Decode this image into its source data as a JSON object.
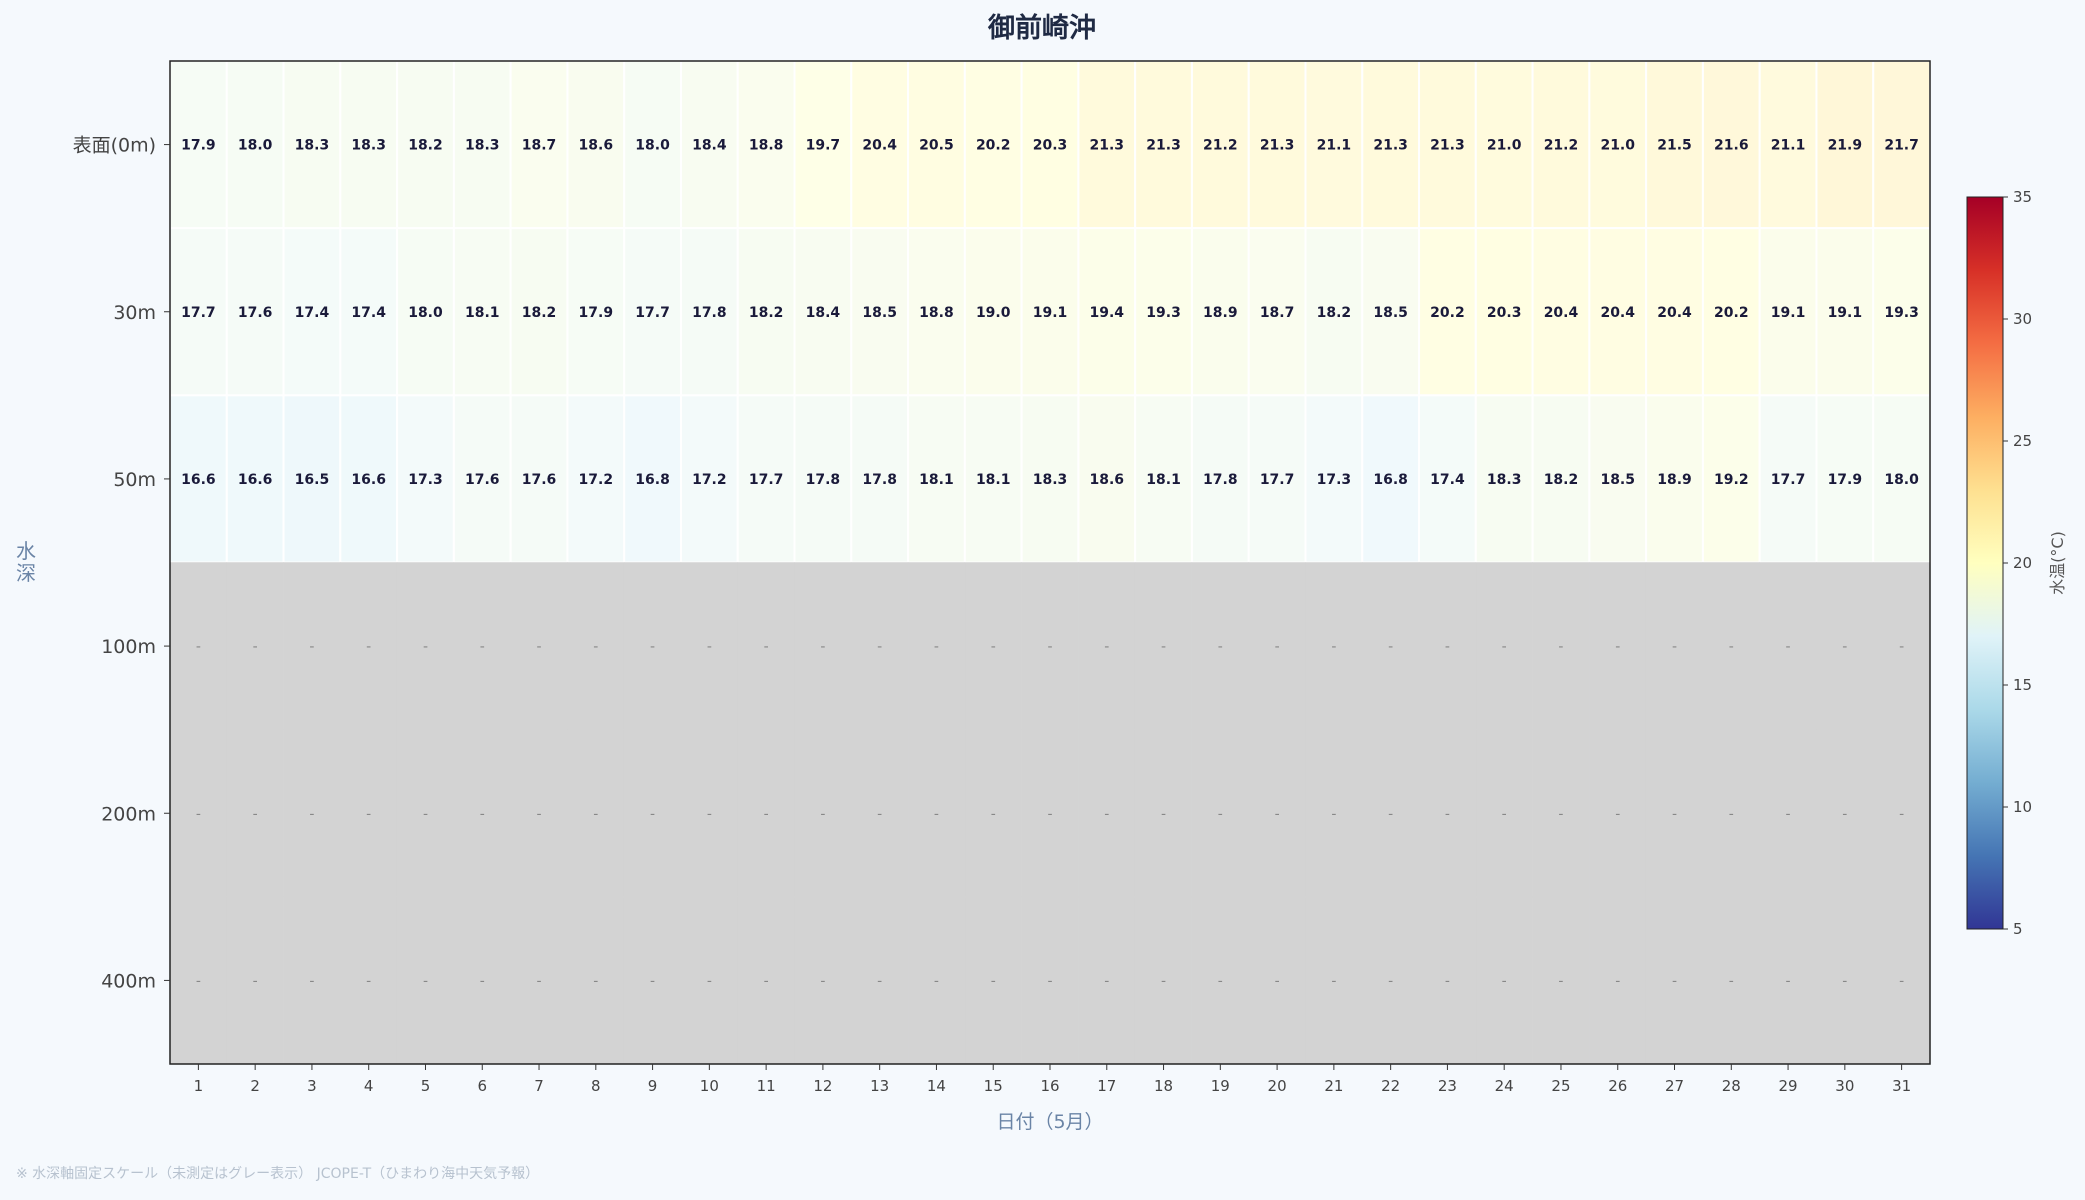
{
  "chart_data": {
    "type": "heatmap",
    "title": "御前崎沖",
    "xlabel": "日付（5月）",
    "ylabel": "水深",
    "x": [
      1,
      2,
      3,
      4,
      5,
      6,
      7,
      8,
      9,
      10,
      11,
      12,
      13,
      14,
      15,
      16,
      17,
      18,
      19,
      20,
      21,
      22,
      23,
      24,
      25,
      26,
      27,
      28,
      29,
      30,
      31
    ],
    "depths": [
      "表面(0m)",
      "30m",
      "50m",
      "100m",
      "200m",
      "400m"
    ],
    "values": [
      [
        17.9,
        18.0,
        18.3,
        18.3,
        18.2,
        18.3,
        18.7,
        18.6,
        18.0,
        18.4,
        18.8,
        19.7,
        20.4,
        20.5,
        20.2,
        20.3,
        21.3,
        21.3,
        21.2,
        21.3,
        21.1,
        21.3,
        21.3,
        21.0,
        21.2,
        21.0,
        21.5,
        21.6,
        21.1,
        21.9,
        21.7
      ],
      [
        17.7,
        17.6,
        17.4,
        17.4,
        18.0,
        18.1,
        18.2,
        17.9,
        17.7,
        17.8,
        18.2,
        18.4,
        18.5,
        18.8,
        19.0,
        19.1,
        19.4,
        19.3,
        18.9,
        18.7,
        18.2,
        18.5,
        20.2,
        20.3,
        20.4,
        20.4,
        20.4,
        20.2,
        19.1,
        19.1,
        19.3
      ],
      [
        16.6,
        16.6,
        16.5,
        16.6,
        17.3,
        17.6,
        17.6,
        17.2,
        16.8,
        17.2,
        17.7,
        17.8,
        17.8,
        18.1,
        18.1,
        18.3,
        18.6,
        18.1,
        17.8,
        17.7,
        17.3,
        16.8,
        17.4,
        18.3,
        18.2,
        18.5,
        18.9,
        19.2,
        17.7,
        17.9,
        18.0
      ],
      [
        null,
        null,
        null,
        null,
        null,
        null,
        null,
        null,
        null,
        null,
        null,
        null,
        null,
        null,
        null,
        null,
        null,
        null,
        null,
        null,
        null,
        null,
        null,
        null,
        null,
        null,
        null,
        null,
        null,
        null,
        null
      ],
      [
        null,
        null,
        null,
        null,
        null,
        null,
        null,
        null,
        null,
        null,
        null,
        null,
        null,
        null,
        null,
        null,
        null,
        null,
        null,
        null,
        null,
        null,
        null,
        null,
        null,
        null,
        null,
        null,
        null,
        null,
        null
      ],
      [
        null,
        null,
        null,
        null,
        null,
        null,
        null,
        null,
        null,
        null,
        null,
        null,
        null,
        null,
        null,
        null,
        null,
        null,
        null,
        null,
        null,
        null,
        null,
        null,
        null,
        null,
        null,
        null,
        null,
        null,
        null
      ]
    ],
    "missing_label": "-",
    "missing_color": "#d3d3d3",
    "colorbar": {
      "label": "水温(°C)",
      "min": 5,
      "max": 35,
      "ticks": [
        5,
        10,
        15,
        20,
        25,
        30,
        35
      ],
      "colormap": "RdYlBu_r",
      "colors": [
        "#313695",
        "#4575b4",
        "#74add1",
        "#abd9e9",
        "#e0f3f8",
        "#ffffbf",
        "#fee090",
        "#fdae61",
        "#f46d43",
        "#d73027",
        "#a50026"
      ]
    }
  },
  "footnote": "※ 水深軸固定スケール（未測定はグレー表示） JCOPE-T（ひまわり海中天気予報）"
}
